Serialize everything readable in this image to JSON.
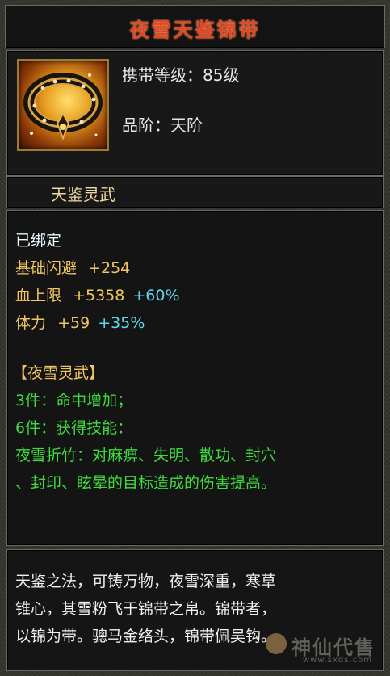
{
  "item": {
    "name": "夜雪天鉴锦带",
    "carry_level": "携带等级：85级",
    "grade": "品阶：天阶",
    "set_name": "天鉴灵武"
  },
  "stats": {
    "bound": "已绑定",
    "lines": [
      {
        "label": "基础闪避",
        "value": "+254",
        "bonus": ""
      },
      {
        "label": "血上限",
        "value": "+5358",
        "bonus": "+60%"
      },
      {
        "label": "体力",
        "value": "+59",
        "bonus": "+35%"
      }
    ],
    "set_title": "【夜雪灵武】",
    "set_effects": [
      "3件：命中增加；",
      "6件：获得技能：",
      "夜雪折竹：对麻痹、失明、散功、封穴",
      "、封印、眩晕的目标造成的伤害提高。"
    ]
  },
  "description": [
    "天鉴之法，可铸万物，夜雪深重，寒草",
    "锥心，其雪粉飞于锦带之帛。锦带者，",
    "以锦为带。骢马金络头，锦带佩吴钩。"
  ],
  "watermark": {
    "text": "神仙代售",
    "url": "www.sxds.com"
  },
  "colors": {
    "title": "#e2462a",
    "attribute": "#f2c660",
    "bonus": "#5ad8f0",
    "set": "#3ddc3d",
    "bound": "#eaf8ff"
  }
}
